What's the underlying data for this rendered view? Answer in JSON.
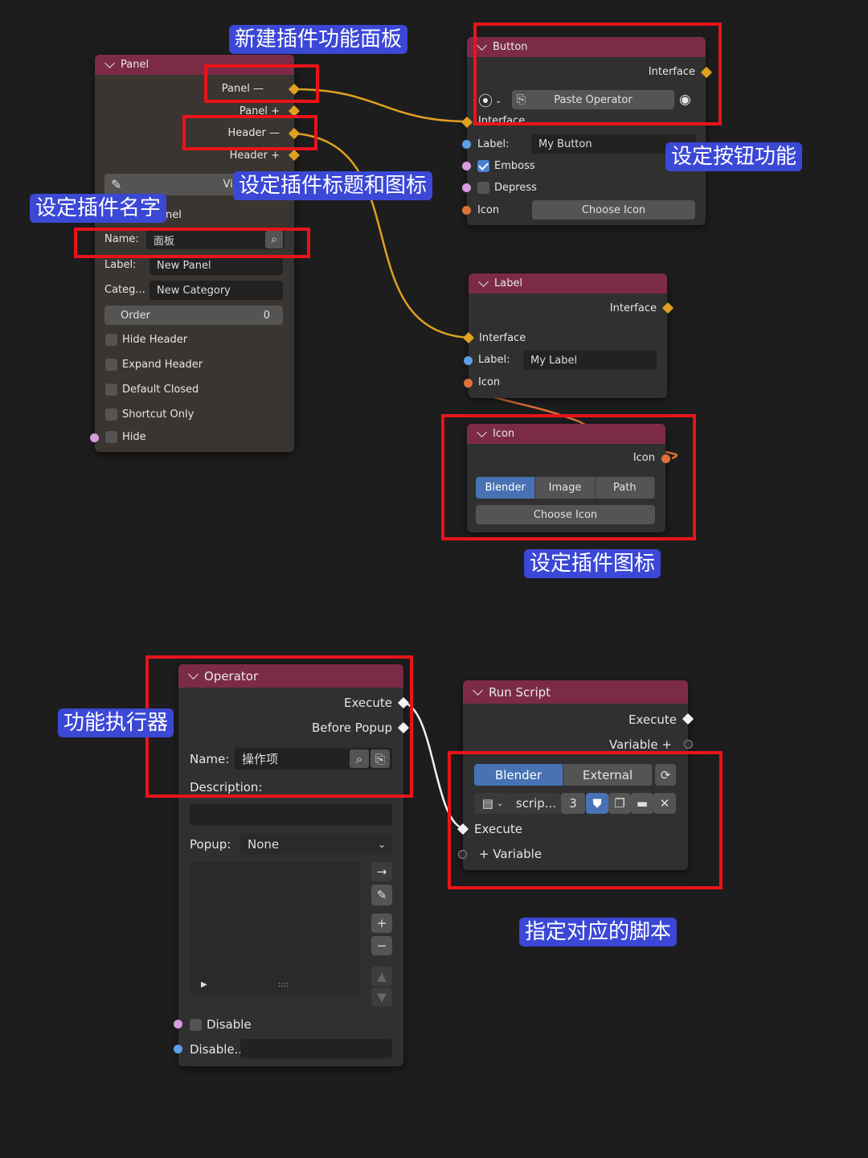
{
  "panel_node": {
    "title": "Panel",
    "outputs": [
      "Panel —",
      "Panel +",
      "Header —",
      "Header +"
    ],
    "view3d_label": "View 3D Ui",
    "hidden_text": "nel",
    "name_label": "Name:",
    "name_value": "面板",
    "label_label": "Label:",
    "label_value": "New Panel",
    "category_label": "Categ...",
    "category_value": "New Category",
    "order_label": "Order",
    "order_value": "0",
    "hide_header": "Hide Header",
    "expand_header": "Expand Header",
    "default_closed": "Default Closed",
    "shortcut_only": "Shortcut Only",
    "hide": "Hide"
  },
  "button_node": {
    "title": "Button",
    "interface_out": "Interface",
    "paste_operator": "Paste Operator",
    "interface_in": "Interface",
    "label_label": "Label:",
    "label_value": "My Button",
    "emboss": "Emboss",
    "depress": "Depress",
    "icon": "Icon",
    "choose_icon": "Choose Icon"
  },
  "label_node": {
    "title": "Label",
    "interface_out": "Interface",
    "interface_in": "Interface",
    "label_label": "Label:",
    "label_value": "My Label",
    "icon": "Icon"
  },
  "icon_node": {
    "title": "Icon",
    "icon_out": "Icon",
    "tabs": [
      "Blender",
      "Image",
      "Path"
    ],
    "choose_icon": "Choose Icon"
  },
  "operator_node": {
    "title": "Operator",
    "execute": "Execute",
    "before_popup": "Before Popup",
    "name_label": "Name:",
    "name_value": "操作项",
    "description_label": "Description:",
    "popup_label": "Popup:",
    "popup_value": "None",
    "disable": "Disable",
    "disable_label": "Disable..."
  },
  "run_script_node": {
    "title": "Run Script",
    "execute_out": "Execute",
    "variable_out": "Variable +",
    "tabs": [
      "Blender",
      "External"
    ],
    "script_name": "scrip...",
    "script_count": "3",
    "execute_in": "Execute",
    "variable_in": "+ Variable"
  },
  "annotations": {
    "new_panel": "新建插件功能面板",
    "set_title_icon": "设定插件标题和图标",
    "set_name": "设定插件名字",
    "set_button": "设定按钮功能",
    "set_icon": "设定插件图标",
    "executor": "功能执行器",
    "assign_script": "指定对应的脚本"
  },
  "colors": {
    "header": "#7b2b48",
    "annotation_bg": "#3b48d6",
    "highlight_box": "#e8141a",
    "interface_socket": "#e0a020",
    "wire_interface": "#e0a020",
    "wire_execute": "#ffffff"
  }
}
